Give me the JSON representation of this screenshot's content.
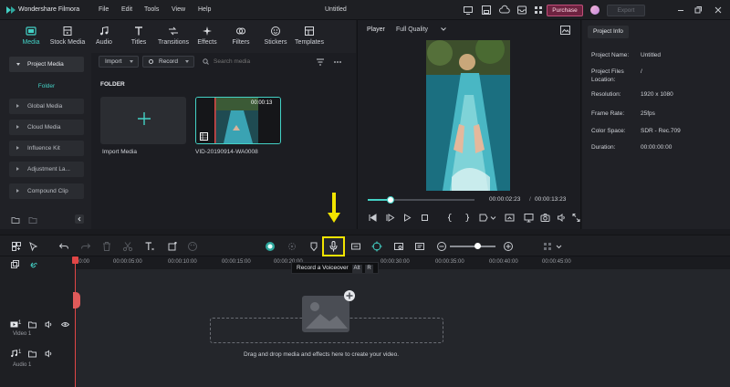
{
  "app": {
    "name": "Wondershare Filmora",
    "title": "Untitled",
    "purchase_label": "Purchase",
    "export_label": "Export"
  },
  "menu": [
    "File",
    "Edit",
    "Tools",
    "View",
    "Help"
  ],
  "media_toolbar": [
    {
      "label": "Media",
      "icon": "media-icon",
      "active": true
    },
    {
      "label": "Stock Media",
      "icon": "stock-media-icon"
    },
    {
      "label": "Audio",
      "icon": "audio-icon"
    },
    {
      "label": "Titles",
      "icon": "titles-icon"
    },
    {
      "label": "Transitions",
      "icon": "transitions-icon"
    },
    {
      "label": "Effects",
      "icon": "effects-icon"
    },
    {
      "label": "Filters",
      "icon": "filters-icon"
    },
    {
      "label": "Stickers",
      "icon": "stickers-icon"
    },
    {
      "label": "Templates",
      "icon": "templates-icon"
    }
  ],
  "sidebar": {
    "project_media": "Project Media",
    "folder": "Folder",
    "items": [
      "Global Media",
      "Cloud Media",
      "Influence Kit",
      "Adjustment La...",
      "Compound Clip"
    ]
  },
  "media_area": {
    "import_label": "Import",
    "record_label": "Record",
    "search_placeholder": "Search media",
    "folder_heading": "FOLDER",
    "import_tile_label": "Import Media",
    "clip_name": "VID-20190914-WA0008",
    "clip_duration": "00:00:13"
  },
  "player": {
    "tab": "Player",
    "quality": "Full Quality",
    "current_time": "00:00:02:23",
    "separator": "/",
    "total_time": "00:00:13:23",
    "progress": 0.21
  },
  "project_info": {
    "tab": "Project Info",
    "rows": [
      {
        "key": "Project Name:",
        "value": "Untitled"
      },
      {
        "key": "Project Files Location:",
        "value": "/"
      },
      {
        "key": "Resolution:",
        "value": "1920 x 1080"
      },
      {
        "key": "Frame Rate:",
        "value": "25fps"
      },
      {
        "key": "Color Space:",
        "value": "SDR - Rec.709"
      },
      {
        "key": "Duration:",
        "value": "00:00:00:00"
      }
    ]
  },
  "timeline": {
    "zoom_level": 0.6,
    "tooltip": "Record a Voiceover",
    "tooltip_keys": [
      "Alt",
      "R"
    ],
    "ruler": [
      "00:00",
      "00:00:05:00",
      "00:00:10:00",
      "00:00:15:00",
      "00:00:20:00",
      "00:00:30:00",
      "00:00:35:00",
      "00:00:40:00",
      "00:00:45:00"
    ],
    "tracks": [
      {
        "label": "Video 1",
        "number": "1"
      },
      {
        "label": "Audio 1",
        "number": "1"
      }
    ],
    "drop_text": "Drag and drop media and effects here to create your video."
  },
  "colors": {
    "accent": "#43d1c5",
    "highlight": "#f2e400",
    "playhead": "#e04646",
    "purchase": "#c04f7a"
  }
}
